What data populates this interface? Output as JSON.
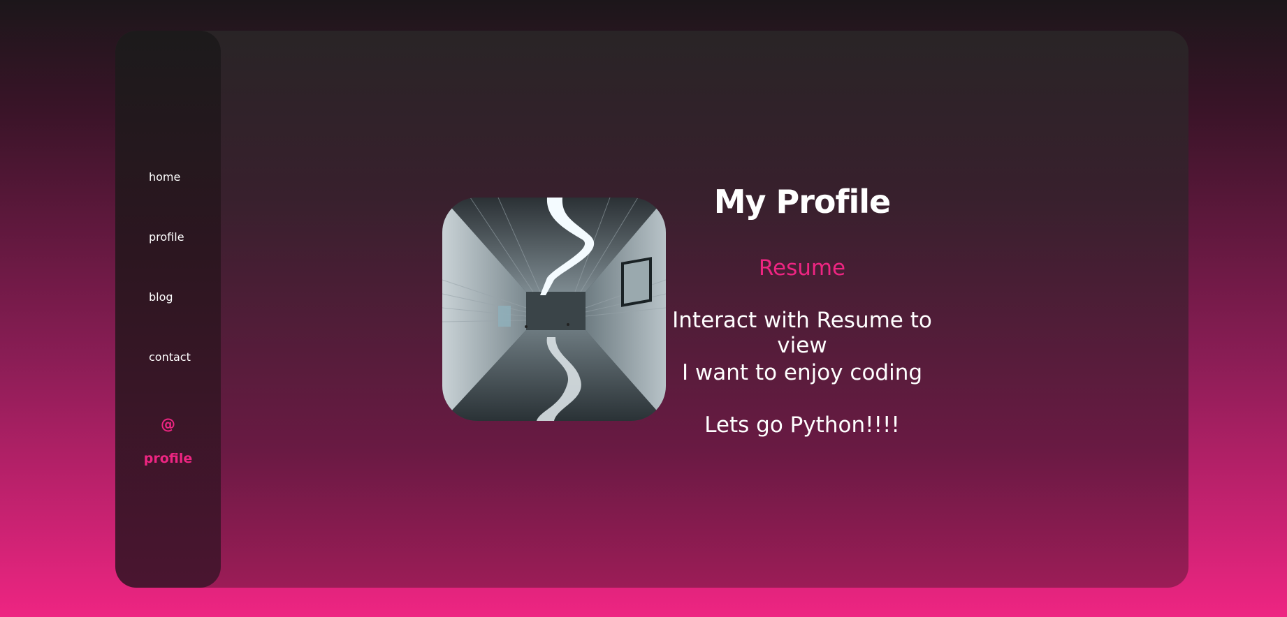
{
  "nav": {
    "items": [
      {
        "label": "home"
      },
      {
        "label": "profile"
      },
      {
        "label": "blog"
      },
      {
        "label": "contact"
      }
    ]
  },
  "brand": {
    "symbol": "@",
    "name": "profile",
    "color": "#ee2582"
  },
  "profile": {
    "title": "My Profile",
    "resume_link": "Resume",
    "lines": [
      "Interact with Resume to view",
      "I want to enjoy coding",
      "Lets go Python!!!!"
    ],
    "photo_icon": "corridor-photo"
  },
  "colors": {
    "accent": "#ee2582",
    "text": "#ffffff"
  }
}
